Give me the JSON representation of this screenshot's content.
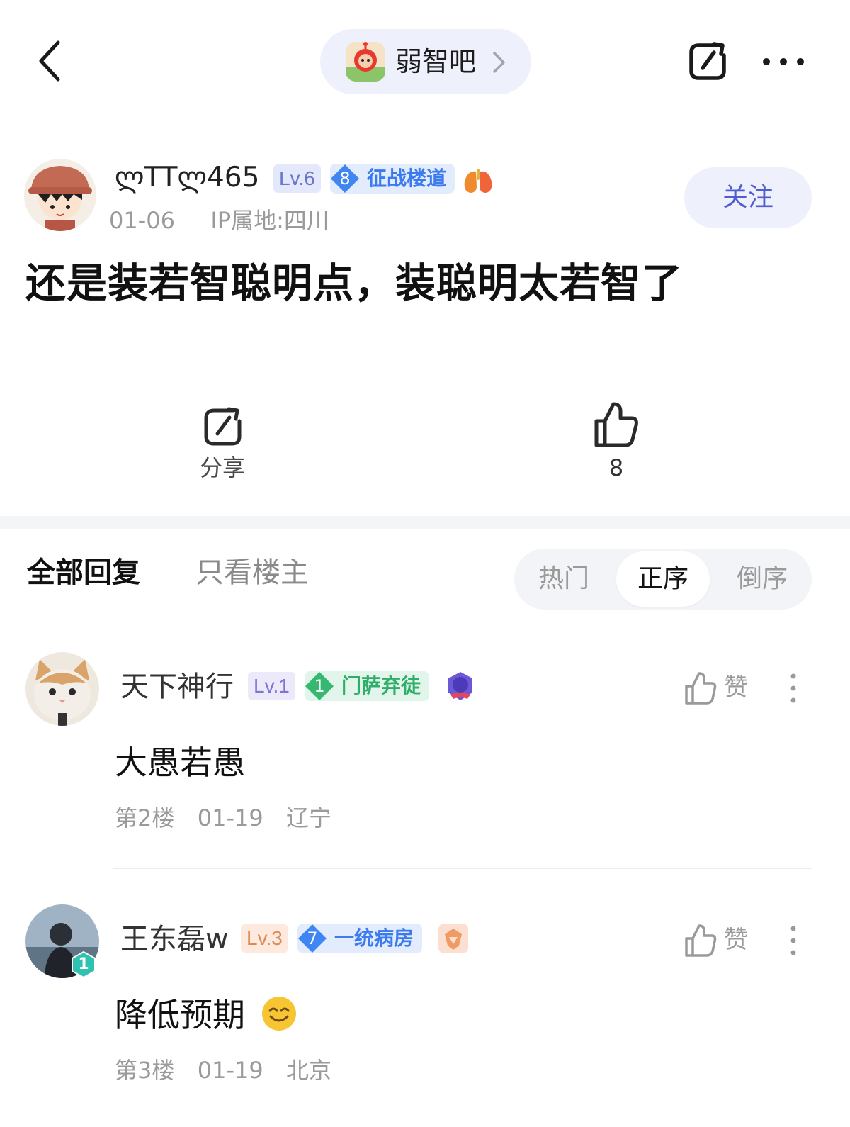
{
  "topbar": {
    "back_icon": "chevron-left-icon",
    "forum_name": "弱智吧",
    "share_icon": "share-icon",
    "more_icon": "more-dots-icon"
  },
  "author": {
    "name": "ლTTლ465",
    "level": "Lv.6",
    "title_level": "8",
    "title_name": "征战楼道",
    "date": "01-06",
    "ip": "IP属地:四川",
    "follow_label": "关注"
  },
  "post": {
    "title": "还是装若智聪明点，装聪明太若智了"
  },
  "actions": {
    "share_label": "分享",
    "like_count": "8"
  },
  "replies_header": {
    "tab_all": "全部回复",
    "tab_op": "只看楼主",
    "sort_options": [
      "热门",
      "正序",
      "倒序"
    ],
    "sort_selected": "正序"
  },
  "replies": [
    {
      "name": "天下神行",
      "level": "Lv.1",
      "title_level": "1",
      "title_name": "门萨弃徒",
      "body": "大愚若愚",
      "floor": "第2楼",
      "date": "01-19",
      "location": "辽宁",
      "like_label": "赞"
    },
    {
      "name": "王东磊w",
      "level": "Lv.3",
      "title_level": "7",
      "title_name": "一统病房",
      "avatar_badge": "1",
      "body": "降低预期",
      "floor": "第3楼",
      "date": "01-19",
      "location": "北京",
      "like_label": "赞"
    }
  ],
  "colors": {
    "accent": "#4f5dd1",
    "pill_bg": "#eef1fc",
    "muted_text": "#9a9a9a",
    "title_blue": "#3b7bee",
    "title_green": "#2fae6a"
  }
}
